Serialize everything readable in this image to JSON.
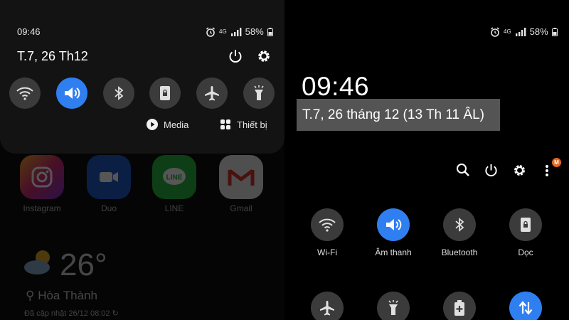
{
  "left": {
    "status": {
      "time": "09:46",
      "network": "4G",
      "battery": "58%"
    },
    "header": {
      "date": "T.7, 26 Th12"
    },
    "quick_tiles": [
      {
        "name": "wifi",
        "active": false
      },
      {
        "name": "sound",
        "active": true
      },
      {
        "name": "bluetooth",
        "active": false
      },
      {
        "name": "rotation-lock",
        "active": false
      },
      {
        "name": "airplane",
        "active": false
      },
      {
        "name": "flashlight",
        "active": false
      }
    ],
    "chips": {
      "media": "Media",
      "devices": "Thiết bị"
    },
    "background_apps": [
      {
        "label": "Instagram"
      },
      {
        "label": "Duo"
      },
      {
        "label": "LINE"
      },
      {
        "label": "Gmail"
      }
    ],
    "weather": {
      "temp": "26°",
      "location": "Hòa Thành",
      "updated": "Đã cập nhật 26/12 08:02"
    }
  },
  "right": {
    "status": {
      "network": "4G",
      "battery": "58%"
    },
    "clock": "09:46",
    "date": "T.7, 26 tháng 12 (13 Th 11 ÂL)",
    "badge": "M",
    "tiles": [
      {
        "label": "Wi-Fi",
        "active": false
      },
      {
        "label": "Âm thanh",
        "active": true
      },
      {
        "label": "Bluetooth",
        "active": false
      },
      {
        "label": "Dọc",
        "active": false
      }
    ]
  },
  "colors": {
    "accent": "#2f7ff0",
    "tile": "#3b3b3b",
    "panel": "#131313",
    "highlight": "#545454",
    "badge": "#e8671c"
  }
}
